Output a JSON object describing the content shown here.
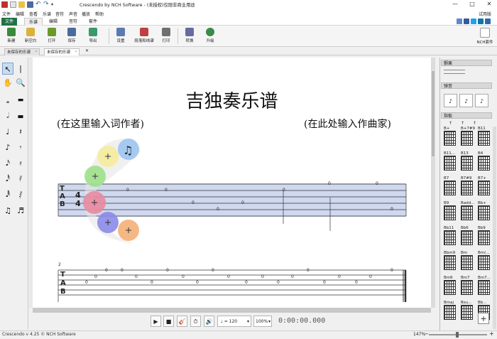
{
  "window": {
    "title": "Crescendo by NCH Software - (未授权)仅限非商业用途",
    "minimize": "—",
    "maximize": "□",
    "close": "✕"
  },
  "menubar": {
    "items": [
      "文件",
      "编辑",
      "查看",
      "乐谱",
      "音符",
      "声音",
      "播放",
      "帮助"
    ],
    "trial_label": "试用版"
  },
  "ribbon_tabs": [
    "文件",
    "乐谱",
    "编辑",
    "音符",
    "套件"
  ],
  "ribbon": {
    "buttons": [
      {
        "label": "新建",
        "icon": "new-file-icon",
        "color": "#3a8a3a"
      },
      {
        "label": "新空白",
        "icon": "blank-score-icon",
        "color": "#d9b23a"
      },
      {
        "label": "打开",
        "icon": "open-folder-icon",
        "color": "#6a9a2a"
      },
      {
        "label": "保存",
        "icon": "save-disk-icon",
        "color": "#4a6aa0"
      },
      {
        "label": "导出",
        "icon": "export-icon",
        "color": "#3a9a6a"
      },
      {
        "label": "设置",
        "icon": "settings-page-icon",
        "color": "#5a7ab0"
      },
      {
        "label": "段落和线谱",
        "icon": "staves-icon",
        "color": "#c04040"
      },
      {
        "label": "打印",
        "icon": "printer-icon",
        "color": "#707070"
      },
      {
        "label": "转换",
        "icon": "convert-icon",
        "color": "#6a6aa0"
      },
      {
        "label": "升级",
        "icon": "upgrade-globe-icon",
        "color": "#3a8a4a"
      }
    ],
    "nch_suite_label": "NCH套件"
  },
  "doc_tabs": [
    {
      "label": "未保存的乐谱",
      "close": "ˣ"
    },
    {
      "label": "未保存的乐谱",
      "close": "ˣ"
    }
  ],
  "score": {
    "title": "吉独奏乐谱",
    "lyricist": "(在这里输入词作者)",
    "composer": "(在此处输入作曲家)",
    "tab_clef": "TAB",
    "time_signature": [
      "4",
      "4"
    ],
    "measure_number_2": "2",
    "fret_values": [
      "0"
    ]
  },
  "transport": {
    "tempo": "♩ = 120",
    "zoom": "100%",
    "time": "0:00:00.000"
  },
  "status": {
    "text": "Crescendo v 4.25 © NCH Software",
    "zoom": "147%"
  },
  "right_panel": {
    "section_top": "颤栗",
    "section_strum": "弹音",
    "section_chords": "指板",
    "chords": [
      "B+",
      "B+7#9",
      "B11",
      "B11...",
      "B13",
      "B4",
      "B7",
      "B7#9",
      "B7+",
      "B9",
      "Badd...",
      "Bb+",
      "Bb11",
      "Bb6",
      "Bb9",
      "Bbm9",
      "Bm",
      "Bm(...",
      "Bm6",
      "Bm7",
      "Bm7...",
      "Bmaj",
      "Bsu...",
      "Bb..."
    ]
  }
}
